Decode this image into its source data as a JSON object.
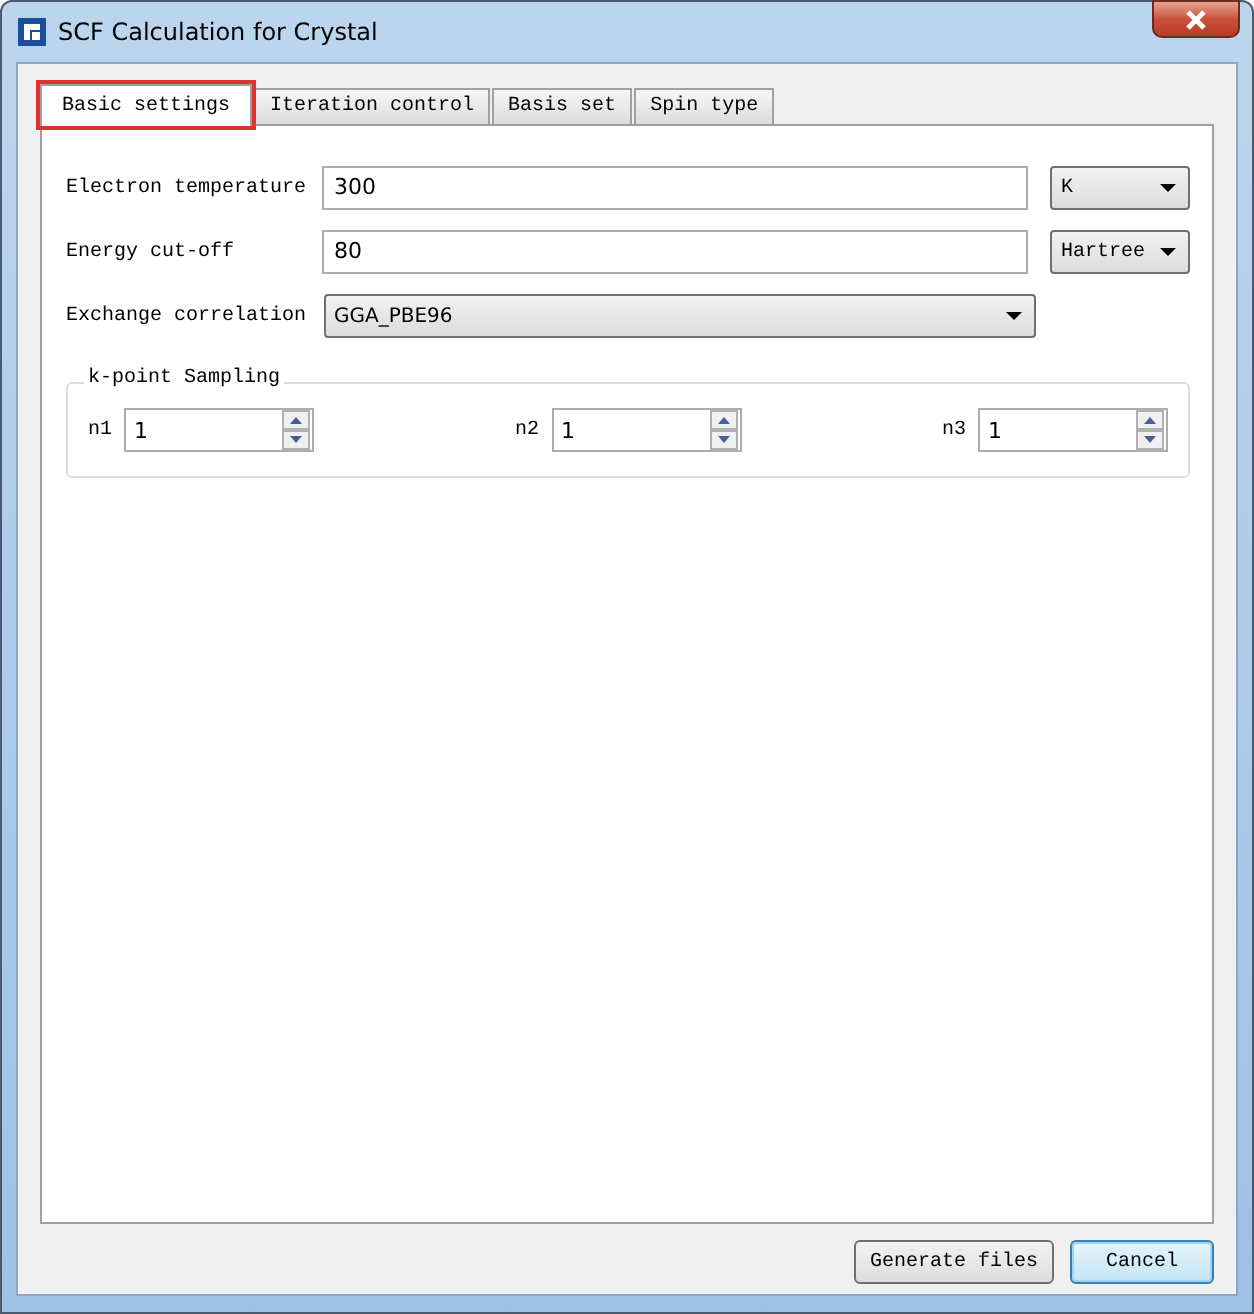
{
  "window": {
    "title": "SCF Calculation for Crystal"
  },
  "tabs": [
    {
      "label": "Basic settings",
      "selected": true,
      "highlighted": true
    },
    {
      "label": "Iteration control",
      "selected": false,
      "highlighted": false
    },
    {
      "label": "Basis set",
      "selected": false,
      "highlighted": false
    },
    {
      "label": "Spin type",
      "selected": false,
      "highlighted": false
    }
  ],
  "fields": [
    {
      "label": "Electron temperature",
      "kind": "text",
      "value": "300",
      "unit": "K"
    },
    {
      "label": "Energy cut-off",
      "kind": "text",
      "value": "80",
      "unit": "Hartree"
    },
    {
      "label": "Exchange correlation",
      "kind": "combo",
      "value": "GGA_PBE96"
    }
  ],
  "kpoint_sampling": {
    "title": "k-point Sampling",
    "spinners": [
      {
        "label": "n1",
        "value": "1"
      },
      {
        "label": "n2",
        "value": "1"
      },
      {
        "label": "n3",
        "value": "1"
      }
    ]
  },
  "buttons": [
    {
      "label": "Generate files",
      "default": false
    },
    {
      "label": "Cancel",
      "default": true
    }
  ]
}
